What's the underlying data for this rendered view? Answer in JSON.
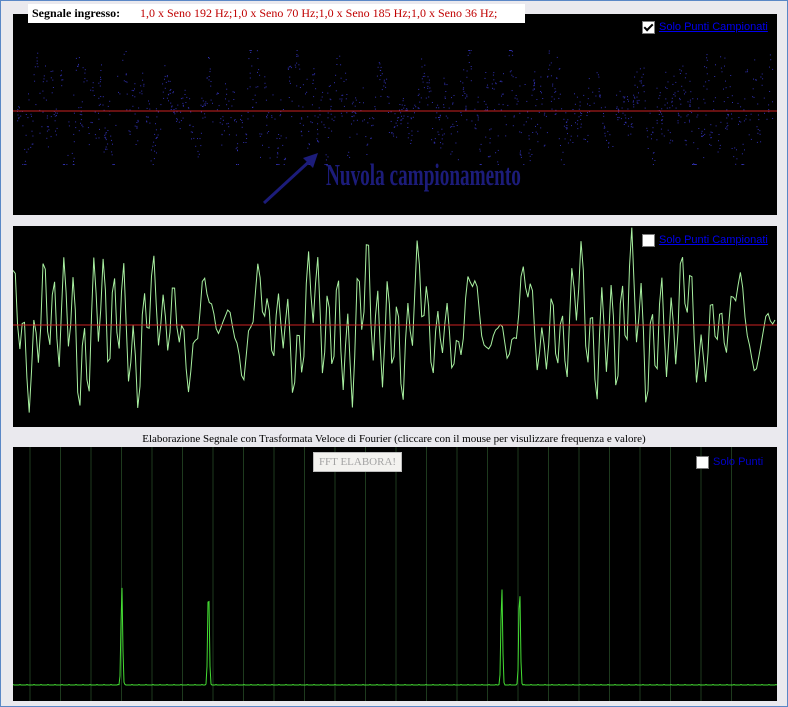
{
  "input": {
    "label": "Segnale ingresso:",
    "value": "1,0 x Seno 192 Hz;1,0 x Seno 70 Hz;1,0 x Seno 185 Hz;1,0 x Seno 36 Hz;"
  },
  "panel1": {
    "checkbox_label": "Solo Punti Campionati",
    "checked": true,
    "annotation": "Nuvola campionamento"
  },
  "panel2": {
    "checkbox_label": "Solo Punti Campionati",
    "checked": false
  },
  "fft": {
    "title": "Elaborazione Segnale con Trasformata Veloce di Fourier (cliccare con il mouse per visulizzare frequenza e valore)",
    "button_label": "FFT ELABORA!",
    "checkbox_label": "Solo Punti",
    "checked": false
  },
  "signal": {
    "components": [
      {
        "amplitude": 1.0,
        "frequency_hz": 192
      },
      {
        "amplitude": 1.0,
        "frequency_hz": 70
      },
      {
        "amplitude": 1.0,
        "frequency_hz": 185
      },
      {
        "amplitude": 1.0,
        "frequency_hz": 36
      }
    ]
  },
  "colors": {
    "waveform": "#a8f0a0",
    "spectrum": "#44dd33",
    "zero_line": "#cc2222",
    "points": "#3030b0",
    "annotation": "#1c1c7a",
    "grid": "#1e3a1e"
  }
}
